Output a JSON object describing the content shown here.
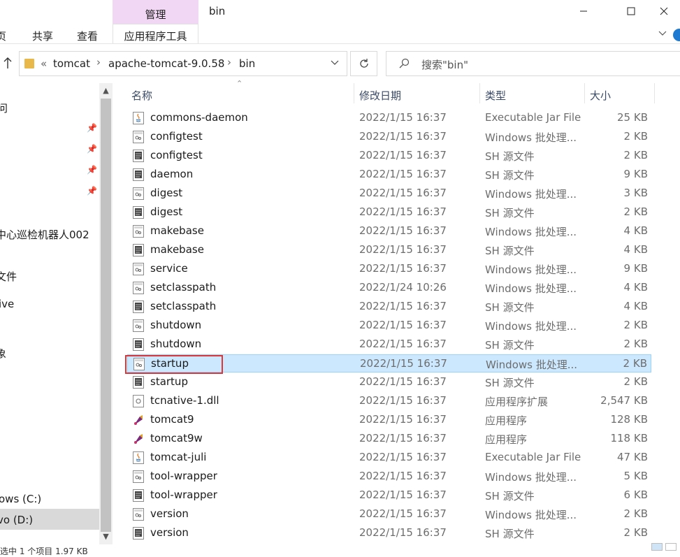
{
  "window": {
    "title": "bin",
    "manage_tab": "管理",
    "minimize_icon": "minimize-icon",
    "maximize_icon": "maximize-icon",
    "close_icon": "close-icon"
  },
  "ribbon": {
    "tabs": [
      "页",
      "共享",
      "查看"
    ],
    "app_tools": "应用程序工具"
  },
  "address": {
    "overflow": "«",
    "breadcrumbs": [
      "tomcat",
      "apache-tomcat-9.0.58",
      "bin"
    ],
    "search_placeholder": "搜索\"bin\""
  },
  "sidebar": {
    "items": [
      "问",
      "中心巡检机器人002",
      "文件",
      "ive",
      "象",
      "ows (C:)",
      "vo (D:)"
    ],
    "selected_item": "vo (D:)"
  },
  "columns": {
    "name": "名称",
    "modified": "修改日期",
    "type": "类型",
    "size": "大小"
  },
  "files": [
    {
      "name": "commons-daemon",
      "date": "2022/1/15 16:37",
      "type": "Executable Jar File",
      "size": "25 KB",
      "icon": "jar"
    },
    {
      "name": "configtest",
      "date": "2022/1/15 16:37",
      "type": "Windows 批处理...",
      "size": "2 KB",
      "icon": "bat"
    },
    {
      "name": "configtest",
      "date": "2022/1/15 16:37",
      "type": "SH 源文件",
      "size": "2 KB",
      "icon": "sh"
    },
    {
      "name": "daemon",
      "date": "2022/1/15 16:37",
      "type": "SH 源文件",
      "size": "9 KB",
      "icon": "sh"
    },
    {
      "name": "digest",
      "date": "2022/1/15 16:37",
      "type": "Windows 批处理...",
      "size": "3 KB",
      "icon": "bat"
    },
    {
      "name": "digest",
      "date": "2022/1/15 16:37",
      "type": "SH 源文件",
      "size": "2 KB",
      "icon": "sh"
    },
    {
      "name": "makebase",
      "date": "2022/1/15 16:37",
      "type": "Windows 批处理...",
      "size": "4 KB",
      "icon": "bat"
    },
    {
      "name": "makebase",
      "date": "2022/1/15 16:37",
      "type": "SH 源文件",
      "size": "4 KB",
      "icon": "sh"
    },
    {
      "name": "service",
      "date": "2022/1/15 16:37",
      "type": "Windows 批处理...",
      "size": "9 KB",
      "icon": "bat"
    },
    {
      "name": "setclasspath",
      "date": "2022/1/24 10:26",
      "type": "Windows 批处理...",
      "size": "4 KB",
      "icon": "bat"
    },
    {
      "name": "setclasspath",
      "date": "2022/1/15 16:37",
      "type": "SH 源文件",
      "size": "4 KB",
      "icon": "sh"
    },
    {
      "name": "shutdown",
      "date": "2022/1/15 16:37",
      "type": "Windows 批处理...",
      "size": "2 KB",
      "icon": "bat"
    },
    {
      "name": "shutdown",
      "date": "2022/1/15 16:37",
      "type": "SH 源文件",
      "size": "2 KB",
      "icon": "sh"
    },
    {
      "name": "startup",
      "date": "2022/1/15 16:37",
      "type": "Windows 批处理...",
      "size": "2 KB",
      "icon": "bat"
    },
    {
      "name": "startup",
      "date": "2022/1/15 16:37",
      "type": "SH 源文件",
      "size": "2 KB",
      "icon": "sh"
    },
    {
      "name": "tcnative-1.dll",
      "date": "2022/1/15 16:37",
      "type": "应用程序扩展",
      "size": "2,547 KB",
      "icon": "dll"
    },
    {
      "name": "tomcat9",
      "date": "2022/1/15 16:37",
      "type": "应用程序",
      "size": "128 KB",
      "icon": "exe"
    },
    {
      "name": "tomcat9w",
      "date": "2022/1/15 16:37",
      "type": "应用程序",
      "size": "118 KB",
      "icon": "exe"
    },
    {
      "name": "tomcat-juli",
      "date": "2022/1/15 16:37",
      "type": "Executable Jar File",
      "size": "47 KB",
      "icon": "jar"
    },
    {
      "name": "tool-wrapper",
      "date": "2022/1/15 16:37",
      "type": "Windows 批处理...",
      "size": "5 KB",
      "icon": "bat"
    },
    {
      "name": "tool-wrapper",
      "date": "2022/1/15 16:37",
      "type": "SH 源文件",
      "size": "6 KB",
      "icon": "sh"
    },
    {
      "name": "version",
      "date": "2022/1/15 16:37",
      "type": "Windows 批处理...",
      "size": "2 KB",
      "icon": "bat"
    },
    {
      "name": "version",
      "date": "2022/1/15 16:37",
      "type": "SH 源文件",
      "size": "2 KB",
      "icon": "sh"
    }
  ],
  "selected_file": "startup",
  "status": {
    "text": "选中 1 个项目 1.97 KB"
  },
  "colors": {
    "selection_bg": "#cce8ff",
    "selection_border": "#99d1ff",
    "annotation_red": "#d9383a",
    "manage_tab_bg": "#f2d7f4"
  }
}
